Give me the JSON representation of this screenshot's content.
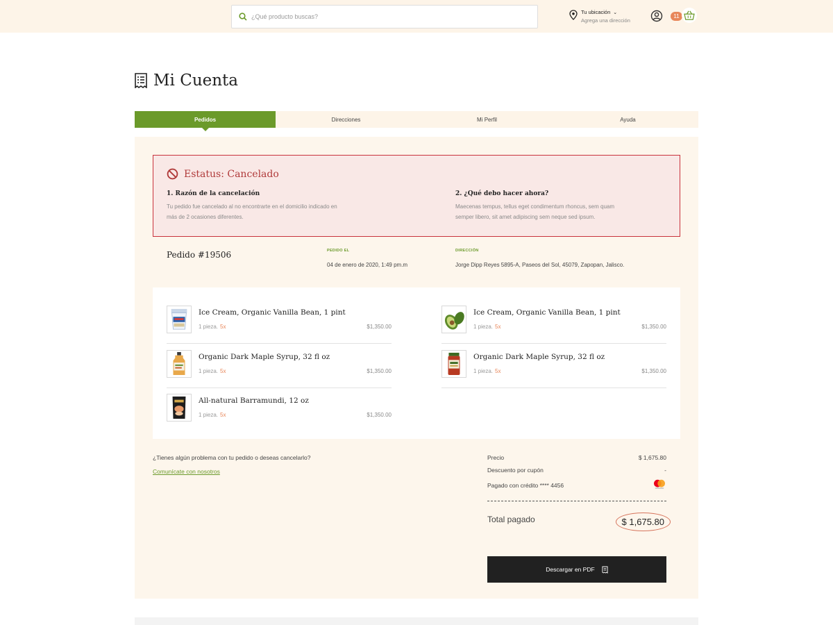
{
  "header": {
    "search_placeholder": "¿Qué producto buscas?",
    "location_title": "Tu ubicación",
    "location_sub": "Agrega una dirección",
    "cart_count": "11",
    "accent_color": "#6b9a2a",
    "badge_color": "#e8875a"
  },
  "page": {
    "title": "Mi Cuenta"
  },
  "tabs": [
    {
      "label": "Pedidos",
      "active": true
    },
    {
      "label": "Direcciones",
      "active": false
    },
    {
      "label": "Mi Perfil",
      "active": false
    },
    {
      "label": "Ayuda",
      "active": false
    }
  ],
  "status": {
    "title": "Estatus: Cancelado",
    "color": "#c8323c",
    "reason_title": "1. Razón de la cancelación",
    "reason_line1": "Tu pedido fue cancelado al no encontrarte en el domicilio indicado en",
    "reason_line2": "más de 2 ocasiones diferentes.",
    "action_title": "2. ¿Qué debo hacer ahora?",
    "action_line1": "Maecenas tempus, tellus eget condimentum rhoncus, sem quam",
    "action_line2": "semper libero, sit amet adipiscing sem neque sed ipsum."
  },
  "order": {
    "number": "Pedido #19506",
    "date_label": "PEDIDO EL",
    "date": "04 de enero de 2020, 1:49 pm.m",
    "address_label": "DIRECCIÓN",
    "address": "Jorge Dipp Reyes 5895-A, Paseos del Sol, 45079, Zapopan, Jalisco."
  },
  "items": [
    {
      "name": "Ice Cream, Organic Vanilla Bean, 1 pint",
      "qty": "1 pieza.",
      "mult": "5x",
      "price": "$1,350.00",
      "thumb": "ice-cream"
    },
    {
      "name": "Ice Cream, Organic Vanilla Bean, 1 pint",
      "qty": "1 pieza.",
      "mult": "5x",
      "price": "$1,350.00",
      "thumb": "avocado"
    },
    {
      "name": "Organic Dark Maple Syrup, 32 fl oz",
      "qty": "1 pieza.",
      "mult": "5x",
      "price": "$1,350.00",
      "thumb": "maple-syrup"
    },
    {
      "name": "Organic Dark Maple Syrup, 32 fl oz",
      "qty": "1 pieza.",
      "mult": "5x",
      "price": "$1,350.00",
      "thumb": "sauce-jar"
    },
    {
      "name": "All-natural Barramundi, 12 oz",
      "qty": "1 pieza.",
      "mult": "5x",
      "price": "$1,350.00",
      "thumb": "fish-bag"
    }
  ],
  "help": {
    "question": "¿Tienes algún problema con tu pedido o deseas cancelarlo?",
    "link": "Comunícate con nosotros"
  },
  "summary": {
    "price_label": "Precio",
    "price": "$ 1,675.80",
    "discount_label": "Descuento por cupón",
    "discount": "-",
    "paid_label": "Pagado con crédito **** 4456",
    "total_label": "Total pagado",
    "total": "$ 1,675.80"
  },
  "pdf_button": "Descargar en PDF"
}
